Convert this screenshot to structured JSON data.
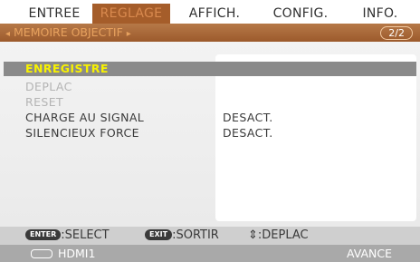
{
  "tabs": [
    "ENTREE",
    "REGLAGE",
    "AFFICH.",
    "CONFIG.",
    "INFO."
  ],
  "subheader": {
    "left_arrow": "◂",
    "title": "MEMOIRE OBJECTIF",
    "right_arrow": "▸",
    "page": "2/2"
  },
  "menu": {
    "items": [
      {
        "label": "ENREGISTRE",
        "value": "",
        "state": "selected"
      },
      {
        "label": "DEPLAC",
        "value": "",
        "state": "disabled"
      },
      {
        "label": "RESET",
        "value": "",
        "state": "disabled"
      },
      {
        "label": "CHARGE AU SIGNAL",
        "value": "DESACT.",
        "state": "normal"
      },
      {
        "label": "SILENCIEUX FORCE",
        "value": "DESACT.",
        "state": "normal"
      }
    ]
  },
  "footer": {
    "enter_key": "ENTER",
    "select_label": ":SELECT",
    "exit_key": "EXIT",
    "exit_label": ":SORTIR",
    "move_symbol": "⇕",
    "move_label": ":DEPLAC",
    "source": "HDMI1",
    "mode": "AVANCE"
  },
  "colors": {
    "accent": "#a55d2a",
    "selected_text": "#f8f200",
    "highlight_row": "#8a8a8a"
  },
  "icons": {
    "source": "hdmi-connector-icon"
  }
}
